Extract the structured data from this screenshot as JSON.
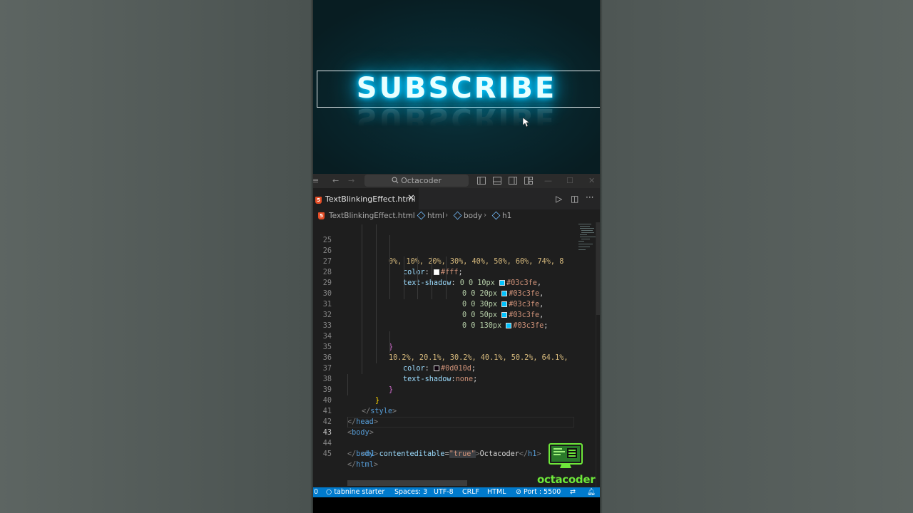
{
  "preview": {
    "heading": "SUBSCRIBE"
  },
  "titlebar": {
    "search_text": "Octacoder",
    "icons": [
      "menu-icon",
      "back-arrow-icon",
      "forward-arrow-icon",
      "search-icon",
      "toggle-primary-sidebar-icon",
      "toggle-panel-icon",
      "toggle-secondary-sidebar-icon",
      "customize-layout-icon",
      "minimize-icon",
      "maximize-icon",
      "close-window-icon"
    ]
  },
  "tab": {
    "label": "TextBlinkingEffect.html",
    "close": "✕"
  },
  "tab_actions": {
    "run": "▷",
    "split": "◫",
    "more": "···"
  },
  "breadcrumbs": {
    "file": "TextBlinkingEffect.html",
    "items": [
      "html",
      "body",
      "h1"
    ]
  },
  "editor": {
    "active_line": "43",
    "lines": [
      {
        "n": "25"
      },
      {
        "n": "26"
      },
      {
        "n": "27"
      },
      {
        "n": "28"
      },
      {
        "n": "29"
      },
      {
        "n": "30"
      },
      {
        "n": "31"
      },
      {
        "n": "32"
      },
      {
        "n": "33"
      },
      {
        "n": "34"
      },
      {
        "n": "35"
      },
      {
        "n": "36"
      },
      {
        "n": "37"
      },
      {
        "n": "38"
      },
      {
        "n": "39"
      },
      {
        "n": "40"
      },
      {
        "n": "41"
      },
      {
        "n": "42"
      },
      {
        "n": "43"
      },
      {
        "n": "44"
      },
      {
        "n": "45"
      }
    ],
    "code": {
      "l25": "0%, 10%, 20%, 30%, 40%, 50%, 60%, 74%, 8",
      "l26_prop": "color",
      "l26_val": "#fff",
      "l27_prop": "text-shadow",
      "l27_num": "0 0 10px",
      "l28_num": "0 0 20px",
      "l29_num": "0 0 30px",
      "l30_num": "0 0 50px",
      "l31_num": "0 0 130px",
      "shadow_color": "#03c3fe",
      "l33": "}",
      "l34": "10.2%, 20.1%, 30.2%, 40.1%, 50.2%, 64.1%,",
      "l35_prop": "color",
      "l35_val": "#0d010d",
      "l36_prop": "text-shadow",
      "l36_val": "none",
      "l37": "}",
      "l38": "}",
      "l39_tag": "style",
      "l41_tag": "head",
      "l42_tag": "body",
      "l43_tag": "h1",
      "l43_attr": "contenteditable",
      "l43_attrval": "\"true\"",
      "l43_text": "Octacoder",
      "l44_tag": "body",
      "l45_tag": "html"
    }
  },
  "logo": {
    "text": "octacoder"
  },
  "statusbar": {
    "left0": "0",
    "tabnine": "tabnine starter",
    "spaces": "Spaces: 3",
    "encoding": "UTF-8",
    "eol": "CRLF",
    "language": "HTML",
    "port": "Port : 5500"
  },
  "colors": {
    "neon": "#03c3fe",
    "statusbar": "#007acc",
    "logo_green": "#6ee83a"
  }
}
